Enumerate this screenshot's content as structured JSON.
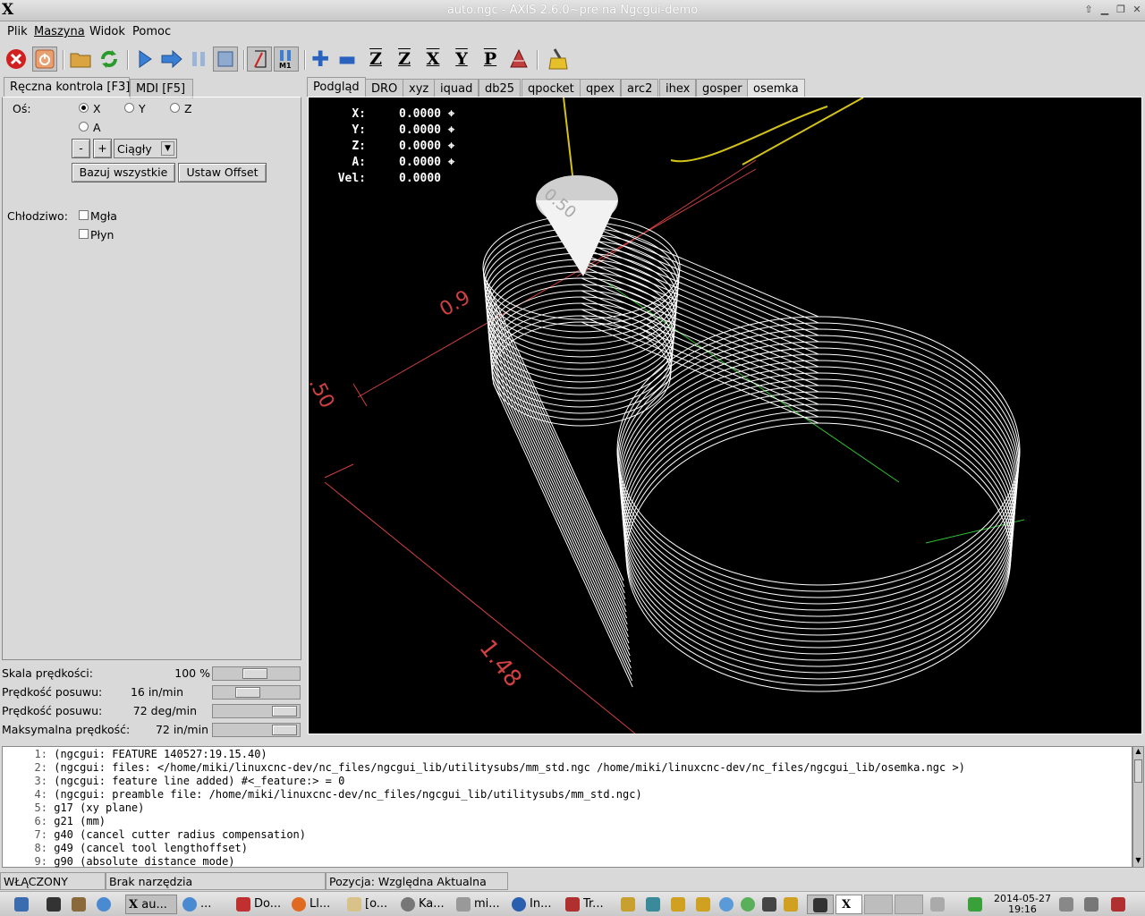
{
  "window": {
    "title": "auto.ngc - AXIS 2.6.0~pre na Ngcgui-demo",
    "logo": "X"
  },
  "menu": [
    "Plik",
    "Maszyna",
    "Widok",
    "Pomoc"
  ],
  "left_tabs": [
    "Ręczna kontrola [F3]",
    "MDI [F5]"
  ],
  "preview_tabs": [
    "Podgląd",
    "DRO",
    "xyz",
    "iquad",
    "db25",
    "qpocket",
    "qpex",
    "arc2",
    "ihex",
    "gosper",
    "osemka"
  ],
  "manual": {
    "axis_label": "Oś:",
    "axes": [
      "X",
      "Y",
      "Z",
      "A"
    ],
    "selected_axis": "X",
    "minus": "-",
    "plus": "+",
    "jog_mode": "Ciągły",
    "home_all": "Bazuj wszystkie",
    "set_offset": "Ustaw Offset",
    "coolant_label": "Chłodziwo:",
    "mist": "Mgła",
    "flood": "Płyn"
  },
  "overrides": [
    {
      "label": "Skala prędkości:",
      "value": "100 %",
      "fraction": 0.48
    },
    {
      "label": "Prędkość posuwu:",
      "value": "16 in/min",
      "fraction": 0.36
    },
    {
      "label": "Prędkość posuwu:",
      "value": "72 deg/min",
      "fraction": 0.95
    },
    {
      "label": "Maksymalna prędkość:",
      "value": "72 in/min",
      "fraction": 0.95
    }
  ],
  "dro": [
    {
      "axis": "X:",
      "value": "0.0000"
    },
    {
      "axis": "Y:",
      "value": "0.0000"
    },
    {
      "axis": "Z:",
      "value": "0.0000"
    },
    {
      "axis": "A:",
      "value": "0.0000"
    },
    {
      "axis": "Vel:",
      "value": "0.0000"
    }
  ],
  "dims": {
    "d1": "0.50",
    "d2": "0.9",
    "d3": ".50",
    "d4": "1.48"
  },
  "gcode": [
    {
      "n": "1:",
      "t": "(ngcgui: FEATURE 140527:19.15.40)"
    },
    {
      "n": "2:",
      "t": "(ngcgui: files: </home/miki/linuxcnc-dev/nc_files/ngcgui_lib/utilitysubs/mm_std.ngc /home/miki/linuxcnc-dev/nc_files/ngcgui_lib/osemka.ngc >)"
    },
    {
      "n": "3:",
      "t": "(ngcgui: feature line added) #<_feature:> = 0"
    },
    {
      "n": "4:",
      "t": "(ngcgui: preamble file: /home/miki/linuxcnc-dev/nc_files/ngcgui_lib/utilitysubs/mm_std.ngc)"
    },
    {
      "n": "5:",
      "t": "g17 (xy plane)"
    },
    {
      "n": "6:",
      "t": "g21 (mm)"
    },
    {
      "n": "7:",
      "t": "g40 (cancel cutter radius compensation)"
    },
    {
      "n": "8:",
      "t": "g49 (cancel tool lengthoffset)"
    },
    {
      "n": "9:",
      "t": "g90 (absolute distance mode)"
    }
  ],
  "status": {
    "state": "WŁĄCZONY",
    "tool": "Brak narzędzia",
    "position": "Pozycja: Względna Aktualna"
  },
  "taskbar": {
    "tasks": [
      "au...",
      "...",
      "Do...",
      "Ll...",
      "[o...",
      "Ka...",
      "mi...",
      "In...",
      "Tr..."
    ],
    "date": "2014-05-27",
    "time": "19:16"
  },
  "colors": {
    "path": "#ffffff",
    "dims": "#d04040",
    "tool": "#d8d8d8",
    "bg": "#000000"
  }
}
